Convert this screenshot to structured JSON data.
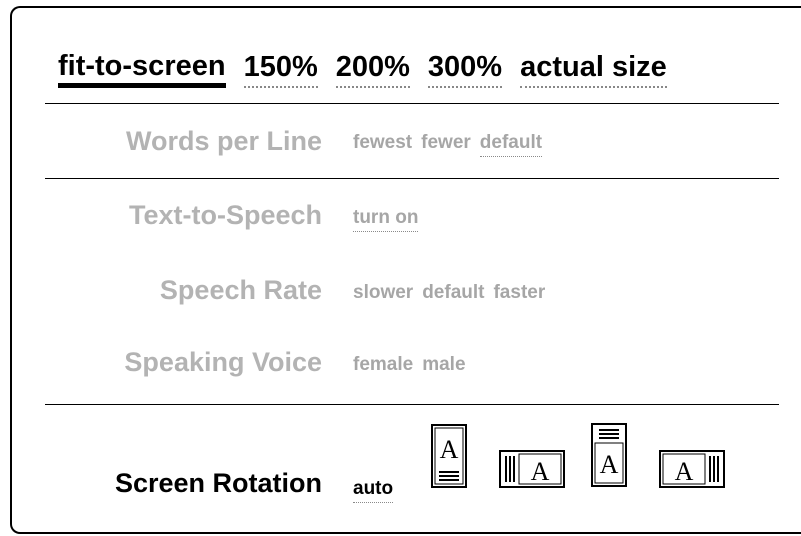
{
  "zoom": {
    "options": [
      "fit-to-screen",
      "150%",
      "200%",
      "300%",
      "actual size"
    ],
    "selected": "fit-to-screen"
  },
  "words_per_line": {
    "label": "Words per Line",
    "options": [
      "fewest",
      "fewer",
      "default"
    ],
    "selected": "default"
  },
  "text_to_speech": {
    "label": "Text-to-Speech",
    "options": [
      "turn on"
    ],
    "selected": "turn on"
  },
  "speech_rate": {
    "label": "Speech Rate",
    "options": [
      "slower",
      "default",
      "faster"
    ]
  },
  "speaking_voice": {
    "label": "Speaking Voice",
    "options": [
      "female",
      "male"
    ]
  },
  "screen_rotation": {
    "label": "Screen Rotation",
    "options": [
      "auto"
    ],
    "selected": "auto",
    "icon_letter": "A",
    "icons": [
      "portrait-keyboard-bottom-icon",
      "landscape-keyboard-left-icon",
      "portrait-keyboard-top-icon",
      "landscape-keyboard-right-icon"
    ]
  }
}
